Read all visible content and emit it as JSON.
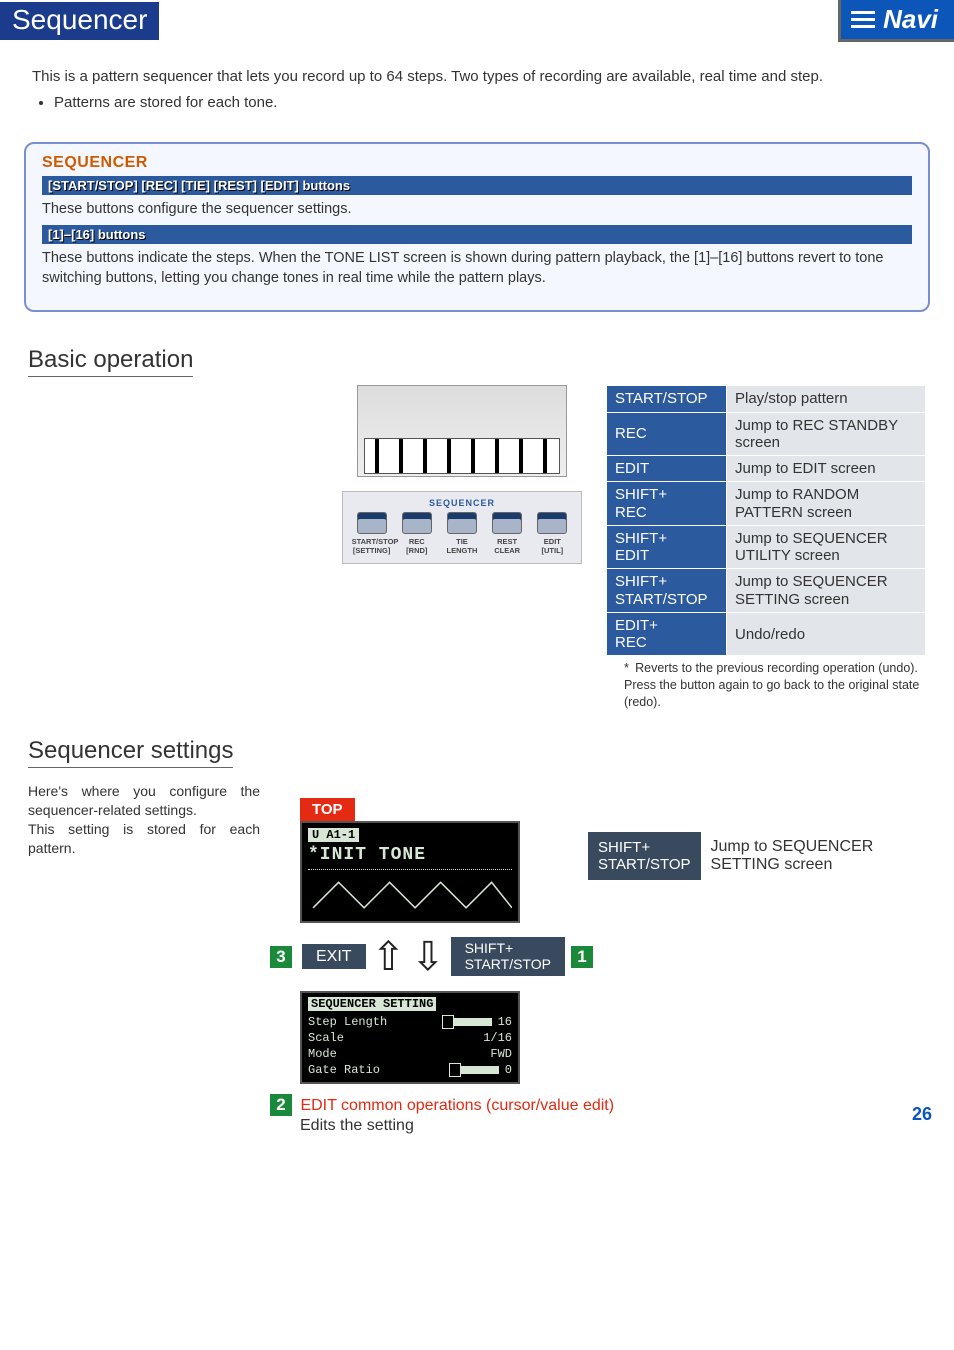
{
  "header": {
    "title": "Sequencer",
    "navi": "Navi"
  },
  "intro": {
    "p1": "This is a pattern sequencer that lets you record up to 64 steps. Two types of recording are available, real time and step.",
    "b1": "Patterns are stored for each tone."
  },
  "panel": {
    "title": "SEQUENCER",
    "bar1": "[START/STOP] [REC] [TIE] [REST] [EDIT] buttons",
    "desc1": "These buttons configure the sequencer settings.",
    "bar2": "[1]–[16] buttons",
    "desc2": "These buttons indicate the steps. When the TONE LIST screen is shown during pattern playback, the [1]–[16] buttons revert to tone switching buttons, letting you change tones in real time while the pattern plays."
  },
  "basic": {
    "heading": "Basic operation",
    "seqBox": {
      "title": "SEQUENCER",
      "b1a": "START/STOP",
      "b1b": "[SETTING]",
      "b2a": "REC",
      "b2b": "[RND]",
      "b3a": "TIE",
      "b3b": "LENGTH",
      "b4a": "REST",
      "b4b": "CLEAR",
      "b5a": "EDIT",
      "b5b": "[UTIL]"
    },
    "ops": [
      {
        "key": "START/STOP",
        "desc": "Play/stop pattern"
      },
      {
        "key": "REC",
        "desc": "Jump to REC STANDBY screen"
      },
      {
        "key": "EDIT",
        "desc": "Jump to EDIT screen"
      },
      {
        "key": "SHIFT+\nREC",
        "desc": "Jump to RANDOM PATTERN screen"
      },
      {
        "key": "SHIFT+\nEDIT",
        "desc": "Jump to SEQUENCER UTILITY screen"
      },
      {
        "key": "SHIFT+\nSTART/STOP",
        "desc": "Jump to SEQUENCER SETTING screen"
      },
      {
        "key": "EDIT+\nREC",
        "desc": "Undo/redo"
      }
    ],
    "footnote": "* Reverts to the previous recording operation (undo). Press the button again to go back to the original state (redo)."
  },
  "settings": {
    "heading": "Sequencer settings",
    "blurb1": "Here's where you configure the sequencer-related settings.",
    "blurb2": "This setting is stored for each pattern.",
    "topBadge": "TOP",
    "lcd1": {
      "bank": "U A1-1",
      "name": "*INIT TONE"
    },
    "jump": {
      "key": "SHIFT+\nSTART/STOP",
      "desc": "Jump to SEQUENCER SETTING screen"
    },
    "navLeftNum": "3",
    "navLeft": "EXIT",
    "navRight": "SHIFT+\nSTART/STOP",
    "navRightNum": "1",
    "lcd2": {
      "hdr": "SEQUENCER SETTING",
      "r1k": "Step Length",
      "r1v": "16",
      "r2k": "Scale",
      "r2v": "1/16",
      "r3k": "Mode",
      "r3v": "FWD",
      "r4k": "Gate Ratio",
      "r4v": "0"
    },
    "calloutNum": "2",
    "calloutA": "EDIT common operations (cursor/value edit)",
    "calloutB": "Edits the setting"
  },
  "page": "26"
}
